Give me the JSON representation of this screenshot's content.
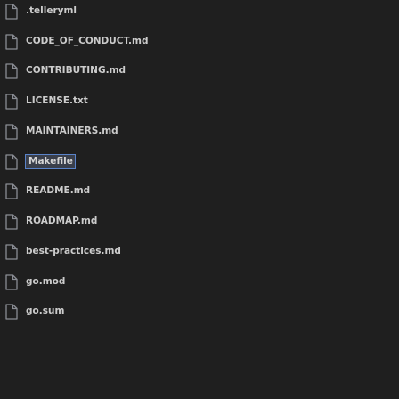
{
  "files": [
    {
      "name": ".telleryml",
      "icon": "file-icon"
    },
    {
      "name": "CODE_OF_CONDUCT.md",
      "icon": "file-icon"
    },
    {
      "name": "CONTRIBUTING.md",
      "icon": "file-icon"
    },
    {
      "name": "LICENSE.txt",
      "icon": "file-icon"
    },
    {
      "name": "MAINTAINERS.md",
      "icon": "file-icon"
    },
    {
      "name": "Makefile",
      "icon": "file-icon",
      "selected": true
    },
    {
      "name": "README.md",
      "icon": "file-icon"
    },
    {
      "name": "ROADMAP.md",
      "icon": "file-icon"
    },
    {
      "name": "best-practices.md",
      "icon": "file-icon"
    },
    {
      "name": "go.mod",
      "icon": "file-icon"
    },
    {
      "name": "go.sum",
      "icon": "file-icon"
    }
  ],
  "colors": {
    "background": "#1f1f1f",
    "text": "#cccccc",
    "icon": "#8a8d94",
    "selection_border": "#5a83c9",
    "selection_background": "#3a3f4b"
  }
}
